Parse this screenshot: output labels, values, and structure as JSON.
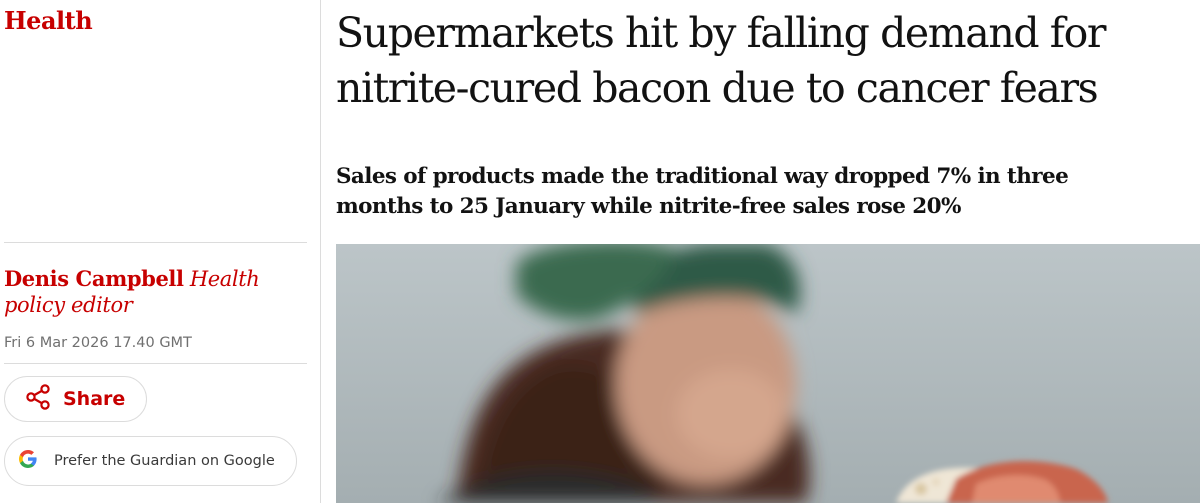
{
  "section": {
    "label": "Health"
  },
  "article": {
    "headline": "Supermarkets hit by falling demand for nitrite-cured bacon due to cancer fears",
    "standfirst": "Sales of products made the traditional way dropped 7% in three months to 25 January while nitrite-free sales rose 20%"
  },
  "byline": {
    "author": "Denis Campbell",
    "role": "Health policy editor",
    "date": "Fri 6 Mar 2026 17.40 GMT"
  },
  "actions": {
    "share_label": "Share",
    "google_label": "Prefer the Guardian on Google"
  },
  "colors": {
    "accent": "#c70000",
    "text": "#121212",
    "muted": "#707070",
    "rule": "#dcdcdc"
  },
  "icons": {
    "share": "share-icon",
    "google": "google-g-icon"
  }
}
